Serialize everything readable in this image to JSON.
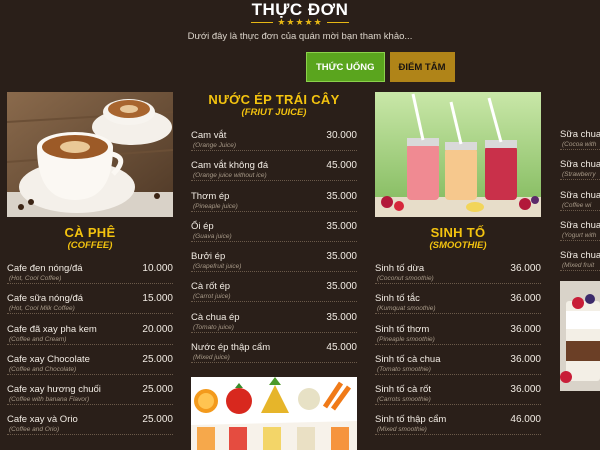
{
  "header": {
    "title": "THỰC ĐƠN",
    "stars": "★★★★★",
    "subtitle": "Dưới đây là thực đơn của quán mời bạn tham khảo..."
  },
  "tabs": [
    {
      "label": "THỨC UỐNG",
      "active": true
    },
    {
      "label": "ĐIỂM TÂM",
      "active": false
    }
  ],
  "colors": {
    "background": "#2a1f19",
    "accent_yellow": "#f3c30f",
    "tab_active": "#5aa51e",
    "tab_inactive": "#b08418"
  },
  "sections": {
    "coffee": {
      "title": "CÀ PHÊ",
      "subtitle": "(COFFEE)",
      "items": [
        {
          "name": "Cafe đen nóng/đá",
          "desc": "(Hot, Cool Coffee)",
          "price": "10.000"
        },
        {
          "name": "Cafe sữa nóng/đá",
          "desc": "(Hot, Cool Milk Coffee)",
          "price": "15.000"
        },
        {
          "name": "Cafe đã xay pha kem",
          "desc": "(Coffee and Cream)",
          "price": "20.000"
        },
        {
          "name": "Cafe xay Chocolate",
          "desc": "(Coffee and Chocolate)",
          "price": "25.000"
        },
        {
          "name": "Cafe xay hương chuối",
          "desc": "(Coffee with banana Flavor)",
          "price": "25.000"
        },
        {
          "name": "Cafe xay và Orio",
          "desc": "(Coffee and Orio)",
          "price": "25.000"
        }
      ]
    },
    "juice": {
      "title": "NƯỚC ÉP TRÁI CÂY",
      "subtitle": "(FRIUT JUICE)",
      "items": [
        {
          "name": "Cam vắt",
          "desc": "(Orange Juice)",
          "price": "30.000"
        },
        {
          "name": "Cam vắt không đá",
          "desc": "(Orange juice without ice)",
          "price": "45.000"
        },
        {
          "name": "Thơm ép",
          "desc": "(Pineaple juice)",
          "price": "35.000"
        },
        {
          "name": "Ổi ép",
          "desc": "(Guava juice)",
          "price": "35.000"
        },
        {
          "name": "Bưởi ép",
          "desc": "(Grapefruit juice)",
          "price": "35.000"
        },
        {
          "name": "Cà rốt ép",
          "desc": "(Carrot juice)",
          "price": "35.000"
        },
        {
          "name": "Cà chua ép",
          "desc": "(Tomato juice)",
          "price": "35.000"
        },
        {
          "name": "Nước ép thập cẩm",
          "desc": "(Mixed juice)",
          "price": "45.000"
        }
      ]
    },
    "smoothie": {
      "title": "SINH TỐ",
      "subtitle": "(SMOOTHIE)",
      "items": [
        {
          "name": "Sinh tố dừa",
          "desc": "(Coconut smoothie)",
          "price": "36.000"
        },
        {
          "name": "Sinh tố tắc",
          "desc": "(Kumquat smoothie)",
          "price": "36.000"
        },
        {
          "name": "Sinh tố thơm",
          "desc": "(Pineaple smoothie)",
          "price": "36.000"
        },
        {
          "name": "Sinh tố cà chua",
          "desc": "(Tomato smoothie)",
          "price": "36.000"
        },
        {
          "name": "Sinh tố cà rốt",
          "desc": "(Carrots smoothie)",
          "price": "36.000"
        },
        {
          "name": "Sinh tố thập cẩm",
          "desc": "(Mixed smoothie)",
          "price": "46.000"
        }
      ]
    },
    "yogurt": {
      "items": [
        {
          "name": "Sữa chua C",
          "desc": "(Cocoa with"
        },
        {
          "name": "Sữa chua d",
          "desc": "(Strawberry"
        },
        {
          "name": "Sữa chua c",
          "desc": "(Coffee wi"
        },
        {
          "name": "Sữa chua t",
          "desc": "(Yogurt with"
        },
        {
          "name": "Sữa chua h",
          "desc": "(Mixed fruit"
        }
      ]
    }
  }
}
